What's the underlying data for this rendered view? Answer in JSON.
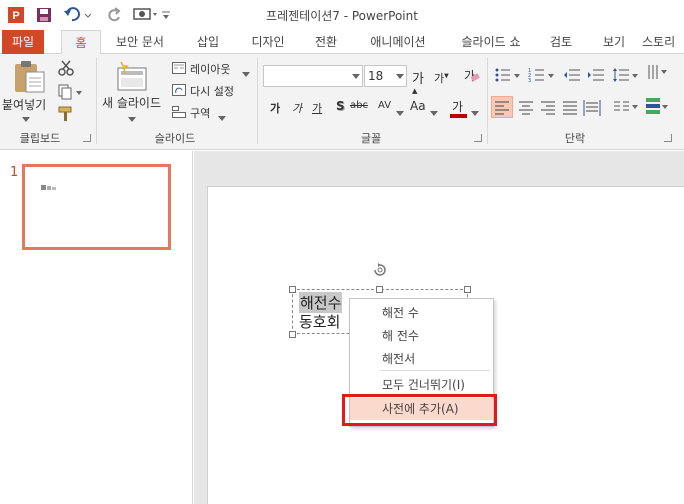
{
  "window": {
    "title": "프레젠테이션7 - PowerPoint"
  },
  "tabs": [
    {
      "id": "file",
      "label": "파일"
    },
    {
      "id": "home",
      "label": "홈"
    },
    {
      "id": "security",
      "label": "보안 문서"
    },
    {
      "id": "insert",
      "label": "삽입"
    },
    {
      "id": "design",
      "label": "디자인"
    },
    {
      "id": "transitions",
      "label": "전환"
    },
    {
      "id": "animations",
      "label": "애니메이션"
    },
    {
      "id": "slideshow",
      "label": "슬라이드 쇼"
    },
    {
      "id": "review",
      "label": "검토"
    },
    {
      "id": "view",
      "label": "보기"
    },
    {
      "id": "storyboard",
      "label": "스토리"
    }
  ],
  "ribbon": {
    "clipboard": {
      "group_label": "클립보드",
      "paste_label": "붙여넣기"
    },
    "slides": {
      "group_label": "슬라이드",
      "new_slide_label": "새 슬라이드",
      "layout_label": "레이아웃",
      "reset_label": "다시 설정",
      "section_label": "구역"
    },
    "font": {
      "group_label": "글꼴",
      "font_name_value": "",
      "font_size_value": "18",
      "bold_label": "가",
      "italic_label": "가",
      "underline_label": "가",
      "shadow_label": "S",
      "strike_label": "abc",
      "spacing_label": "AV",
      "case_label": "Aa",
      "color_label": "가"
    },
    "paragraph": {
      "group_label": "단락"
    }
  },
  "slides_pane": {
    "slide_number": "1"
  },
  "slide": {
    "textbox_line1": "해전수",
    "textbox_line2": "동호회"
  },
  "context_menu": {
    "suggestions": [
      "해전 수",
      "해 전수",
      "해전서"
    ],
    "ignore_all": "모두 건너뛰기(I)",
    "add_to_dictionary": "사전에 추가(A)"
  },
  "colors": {
    "accent": "#d24726",
    "highlight_box": "#e8171b",
    "menu_hover": "#fbd9cd"
  }
}
